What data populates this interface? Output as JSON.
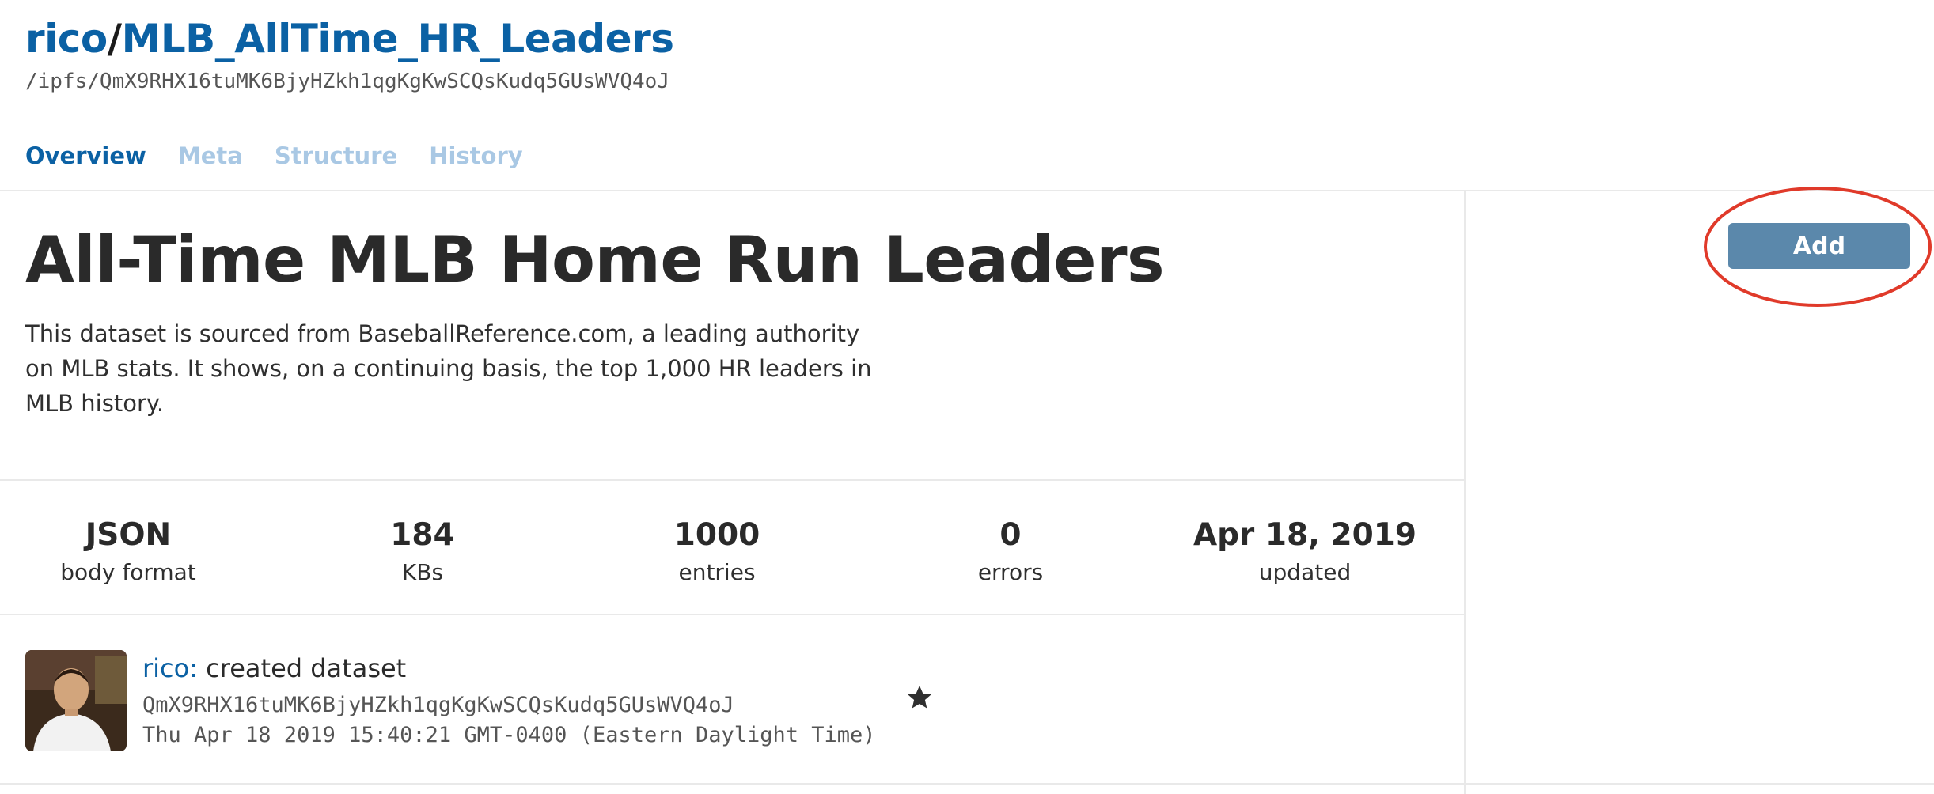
{
  "header": {
    "peername": "rico",
    "separator": "/",
    "dataset_name": "MLB_AllTime_HR_Leaders",
    "path": "/ipfs/QmX9RHX16tuMK6BjyHZkh1qgKgKwSCQsKudq5GUsWVQ4oJ"
  },
  "tabs": [
    {
      "label": "Overview",
      "active": true
    },
    {
      "label": "Meta",
      "active": false
    },
    {
      "label": "Structure",
      "active": false
    },
    {
      "label": "History",
      "active": false
    }
  ],
  "main": {
    "title": "All-Time MLB Home Run Leaders",
    "description": "This dataset is sourced from BaseballReference.com, a leading authority on MLB stats. It shows, on a continuing basis, the top 1,000 HR leaders in MLB history."
  },
  "actions": {
    "add_label": "Add",
    "highlight_color": "#e03a2a"
  },
  "stats": [
    {
      "value": "JSON",
      "label": "body format"
    },
    {
      "value": "184",
      "label": "KBs"
    },
    {
      "value": "1000",
      "label": "entries"
    },
    {
      "value": "0",
      "label": "errors"
    },
    {
      "value": "Apr 18, 2019",
      "label": "updated"
    }
  ],
  "commit": {
    "author": "rico:",
    "message": "created dataset",
    "hash": "QmX9RHX16tuMK6BjyHZkh1qgKgKwSCQsKudq5GUsWVQ4oJ",
    "timestamp": "Thu Apr 18 2019 15:40:21 GMT-0400 (Eastern Daylight Time)",
    "icon": "star-icon"
  },
  "colors": {
    "link": "#0b61a4",
    "tab_inactive": "#a9c8e4",
    "button": "#5b88ab"
  }
}
